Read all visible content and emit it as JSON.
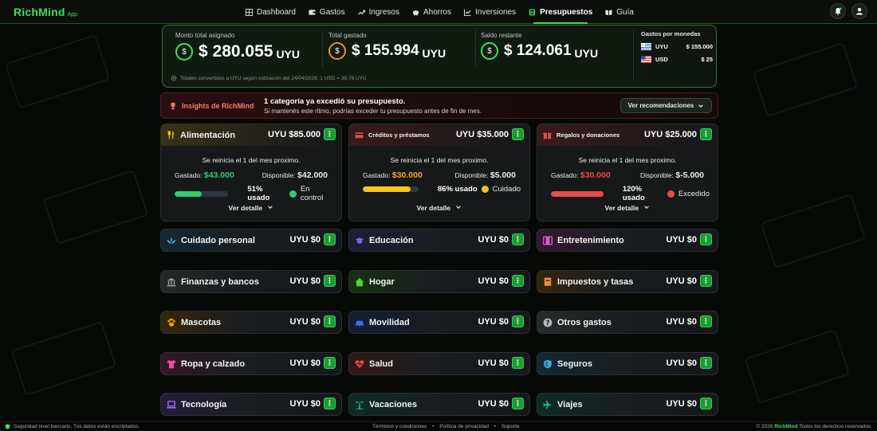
{
  "app": {
    "name": "RichMind",
    "tag": "App"
  },
  "nav": [
    {
      "label": "Dashboard",
      "icon": "dashboard-icon",
      "active": false
    },
    {
      "label": "Gastos",
      "icon": "wallet-icon",
      "active": false
    },
    {
      "label": "Ingresos",
      "icon": "trend-up-icon",
      "active": false
    },
    {
      "label": "Ahorros",
      "icon": "piggy-icon",
      "active": false
    },
    {
      "label": "Inversiones",
      "icon": "chart-icon",
      "active": false
    },
    {
      "label": "Presupuestos",
      "icon": "calculator-icon",
      "active": true
    },
    {
      "label": "Guía",
      "icon": "book-icon",
      "active": false
    }
  ],
  "summary": {
    "assigned": {
      "label": "Monto total asignado",
      "symbol": "$",
      "amount": "$ 280.055",
      "currency": "UYU"
    },
    "spent": {
      "label": "Total gastado",
      "symbol": "$",
      "amount": "$ 155.994",
      "currency": "UYU"
    },
    "remaining": {
      "label": "Saldo restante",
      "symbol": "$",
      "amount": "$ 124.061",
      "currency": "UYU"
    },
    "note": "Totales convertidos a UYU según cotización del 24/04/2026: 1 USD = 39,76 UYU",
    "by_currency": {
      "title": "Gastos por monedas",
      "rows": [
        {
          "code": "UYU",
          "amount": "$ 155.000"
        },
        {
          "code": "USD",
          "amount": "$ 25"
        }
      ]
    }
  },
  "insights": {
    "label": "Insights de RichMind",
    "title": "1 categoría ya excedió su presupuesto.",
    "text": "Si mantenés este ritmo, podrías exceder tu presupuesto antes de fin de mes.",
    "button": "Ver recomendaciones"
  },
  "expanded_cards": [
    {
      "name": "Alimentación",
      "amount": "UYU $85.000",
      "reset": "Se reinicia el 1 del mes proximo.",
      "spent_label": "Gastado:",
      "spent": "$43.000",
      "available_label": "Disponible:",
      "available": "$42.000",
      "progress": 0.51,
      "pct": "51% usado",
      "status": "En control",
      "status_color": "#2ecc71",
      "bar_color": "#2ecc71",
      "spent_color": "#2ecc71",
      "detail": "Ver detalle"
    },
    {
      "name": "Créditos y préstamos",
      "amount": "UYU $35.000",
      "reset": "Se reinicia el 1 del mes proximo.",
      "spent_label": "Gastado:",
      "spent": "$30.000",
      "available_label": "Disponible:",
      "available": "$5.000",
      "progress": 0.86,
      "pct": "86% usado",
      "status": "Cuidado",
      "status_color": "#f5c518",
      "bar_color": "#f5c518",
      "spent_color": "#f5a623",
      "detail": "Ver detalle"
    },
    {
      "name": "Regalos y donaciones",
      "amount": "UYU $25.000",
      "reset": "Se reinicia el 1 del mes proximo.",
      "spent_label": "Gastado:",
      "spent": "$30.000",
      "available_label": "Disponible:",
      "available": "$-5.000",
      "progress": 1.0,
      "pct": "120% usado",
      "status": "Excedido",
      "status_color": "#e74c4c",
      "bar_color": "#e74c4c",
      "spent_color": "#e74c4c",
      "detail": "Ver detalle"
    }
  ],
  "categories": [
    {
      "name": "Cuidado personal",
      "amount": "UYU $0",
      "icon": "lotus-icon",
      "color": "#3fa8e0"
    },
    {
      "name": "Educación",
      "amount": "UYU $0",
      "icon": "graduation-cap-icon",
      "color": "#7b6cf0"
    },
    {
      "name": "Entretenimiento",
      "amount": "UYU $0",
      "icon": "film-icon",
      "color": "#e05ad0"
    },
    {
      "name": "Finanzas y bancos",
      "amount": "UYU $0",
      "icon": "bank-icon",
      "color": "#9aa0a6"
    },
    {
      "name": "Hogar",
      "amount": "UYU $0",
      "icon": "house-icon",
      "color": "#4cd137"
    },
    {
      "name": "Impuestos y tasas",
      "amount": "UYU $0",
      "icon": "receipt-icon",
      "color": "#e8912c"
    },
    {
      "name": "Mascotas",
      "amount": "UYU $0",
      "icon": "paw-icon",
      "color": "#f39c12"
    },
    {
      "name": "Movilidad",
      "amount": "UYU $0",
      "icon": "car-icon",
      "color": "#3b6cf0"
    },
    {
      "name": "Otros gastos",
      "amount": "UYU $0",
      "icon": "question-icon",
      "color": "#b0b6bc"
    },
    {
      "name": "Ropa y calzado",
      "amount": "UYU $0",
      "icon": "shirt-icon",
      "color": "#e84c9c"
    },
    {
      "name": "Salud",
      "amount": "UYU $0",
      "icon": "heart-pulse-icon",
      "color": "#e74c4c"
    },
    {
      "name": "Seguros",
      "amount": "UYU $0",
      "icon": "shield-icon",
      "color": "#3fa8e0"
    },
    {
      "name": "Tecnología",
      "amount": "UYU $0",
      "icon": "laptop-icon",
      "color": "#9b6cf0"
    },
    {
      "name": "Vacaciones",
      "amount": "UYU $0",
      "icon": "palm-tree-icon",
      "color": "#1abc9c"
    },
    {
      "name": "Viajes",
      "amount": "UYU $0",
      "icon": "plane-icon",
      "color": "#1abc9c"
    }
  ],
  "footer": {
    "security": "Seguridad nivel bancario. Tus datos están encriptados.",
    "links": [
      "Términos y condiciones",
      "Política de privacidad",
      "Soporte"
    ],
    "copyright_prefix": "© 2026",
    "brand": "RichMind",
    "copyright_suffix": "Todos los derechos reservados."
  }
}
